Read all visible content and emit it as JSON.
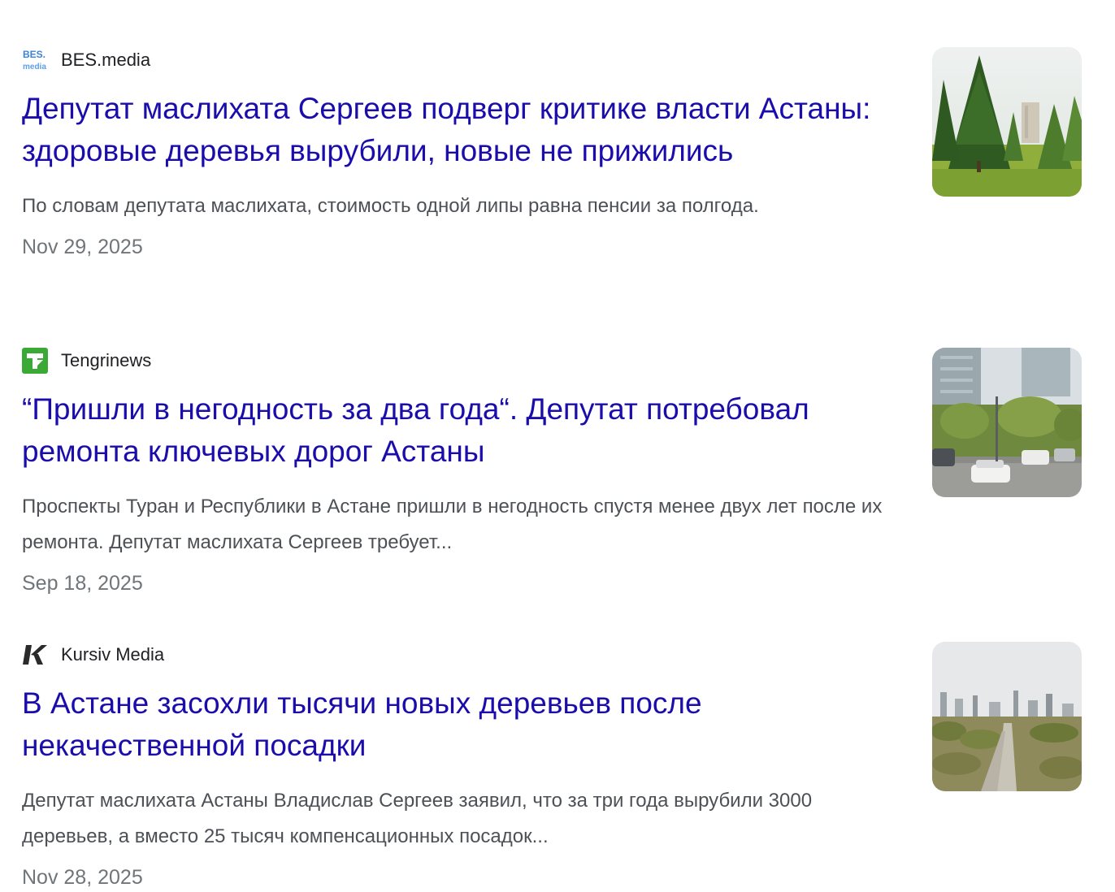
{
  "articles": [
    {
      "source": "BES.media",
      "favicon": "bes-media-logo-icon",
      "headline": "Депутат маслихата Сергеев подверг критике власти Астаны: здоровые деревья вырубили, новые не прижились",
      "snippet": "По словам депутата маслихата, стоимость одной липы равна пенсии за полгода.",
      "date": "Nov 29, 2025",
      "thumbnail": "trees-park-thumbnail"
    },
    {
      "source": "Tengrinews",
      "favicon": "tengrinews-logo-icon",
      "headline": "“Пришли в негодность за два года“. Депутат потребовал ремонта ключевых дорог Астаны",
      "snippet": "Проспекты Туран и Республики в Астане пришли в негодность спустя менее двух лет после их ремонта. Депутат маслихата Сергеев требует...",
      "date": "Sep 18, 2025",
      "thumbnail": "city-road-cars-thumbnail"
    },
    {
      "source": "Kursiv Media",
      "favicon": "kursiv-logo-icon",
      "headline": "В Астане засохли тысячи новых деревьев после некачественной посадки",
      "snippet": "Депутат маслихата Астаны Владислав Сергеев заявил, что за три года вырубили 3000 деревьев, а вместо 25 тысяч компенсационных посадок...",
      "date": "Nov 28, 2025",
      "thumbnail": "city-park-skyline-thumbnail"
    }
  ],
  "colors": {
    "headline_link": "#1a0dab",
    "snippet_text": "#4d5156",
    "date_text": "#70757a",
    "source_text": "#202124"
  }
}
